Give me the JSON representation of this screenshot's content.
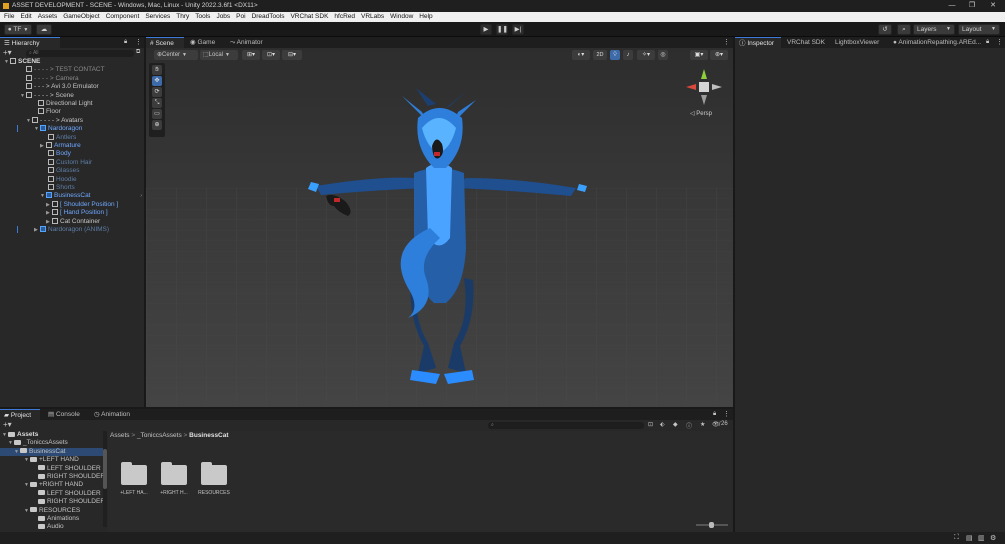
{
  "window": {
    "title": "ASSET DEVELOPMENT - SCENE - Windows, Mac, Linux - Unity 2022.3.6f1 <DX11>",
    "minimize": "—",
    "maximize": "❐",
    "close": "✕"
  },
  "menu": [
    "File",
    "Edit",
    "Assets",
    "GameObject",
    "Component",
    "Services",
    "Thry",
    "Tools",
    "Jobs",
    "Poi",
    "DreadTools",
    "VRChat SDK",
    "hfcRed",
    "VRLabs",
    "Window",
    "Help"
  ],
  "toolbar": {
    "account": "TF",
    "layers": "Layers",
    "layout": "Layout"
  },
  "hierarchy": {
    "tab": "Hierarchy",
    "search_placeholder": "All",
    "items": [
      {
        "label": "SCENE"
      },
      {
        "label": "- - - - > TEST CONTACT"
      },
      {
        "label": "- - - - > Camera"
      },
      {
        "label": "- - - > Avi 3.0 Emulator"
      },
      {
        "label": "- - - - > Scene"
      },
      {
        "label": "Directional Light"
      },
      {
        "label": "Floor"
      },
      {
        "label": "- - - - > Avatars"
      },
      {
        "label": "Nardoragon"
      },
      {
        "label": "Antlers"
      },
      {
        "label": "Armature"
      },
      {
        "label": "Body"
      },
      {
        "label": "Custom Hair"
      },
      {
        "label": "Glasses"
      },
      {
        "label": "Hoodie"
      },
      {
        "label": "Shorts"
      },
      {
        "label": "BusinessCat"
      },
      {
        "label": "[ Shoulder Position ]"
      },
      {
        "label": "[ Hand Position ]"
      },
      {
        "label": "Cat Container"
      },
      {
        "label": "Nardoragon (ANIMS)"
      }
    ]
  },
  "scene": {
    "tabs": [
      "Scene",
      "Game",
      "Animator"
    ],
    "pivot": "Center",
    "space": "Local",
    "mode2d": "2D",
    "persp": "◁ Persp"
  },
  "inspector": {
    "tabs": [
      "Inspector",
      "VRChat SDK",
      "LightboxViewer",
      "● AnimationRepathing.AREd..."
    ]
  },
  "project": {
    "tabs": [
      "Project",
      "Console",
      "Animation"
    ],
    "tree": [
      {
        "label": "Assets"
      },
      {
        "label": "_ToniccsAssets"
      },
      {
        "label": "BusinessCat"
      },
      {
        "label": "+LEFT HAND"
      },
      {
        "label": "LEFT SHOULDER"
      },
      {
        "label": "RIGHT SHOULDER"
      },
      {
        "label": "+RIGHT HAND"
      },
      {
        "label": "LEFT SHOULDER"
      },
      {
        "label": "RIGHT SHOULDER"
      },
      {
        "label": "RESOURCES"
      },
      {
        "label": "Animations"
      },
      {
        "label": "Audio"
      }
    ],
    "breadcrumb": [
      "Assets",
      "_ToniccsAssets",
      "BusinessCat"
    ],
    "breadcrumb_sep": ">",
    "assets": [
      "+LEFT HA...",
      "+RIGHT H...",
      "RESOURCES"
    ],
    "count": "26"
  },
  "colors": {
    "accent": "#3d7ad6",
    "dragon_blue": "#2e7fdc",
    "dragon_dark": "#1c3f73"
  }
}
